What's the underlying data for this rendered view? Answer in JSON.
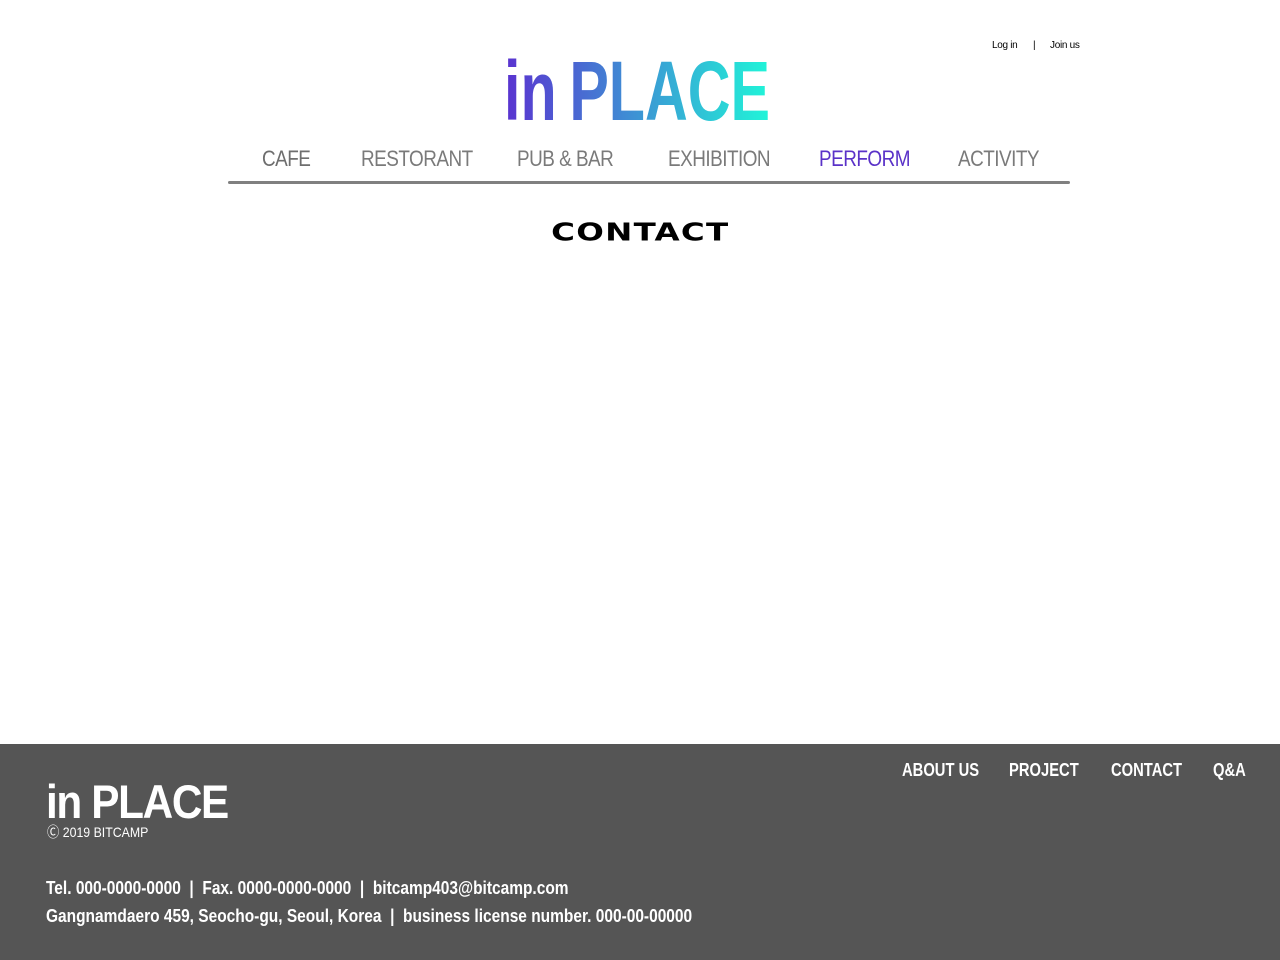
{
  "header": {
    "account": {
      "login_label": "Log in",
      "separator": "|",
      "join_label": "Join us"
    },
    "logo": {
      "text_in": "in",
      "text_place": "PLACE",
      "gradient_start": "#5a32d0",
      "gradient_end": "#20f5d8"
    }
  },
  "main_nav": {
    "items": [
      {
        "label": "CAFE"
      },
      {
        "label": "RESTORANT"
      },
      {
        "label": "PUB & BAR"
      },
      {
        "label": "EXHIBITION"
      },
      {
        "label": "PERFORM",
        "active": true
      },
      {
        "label": "ACTIVITY"
      }
    ],
    "active_color": "#5a32c8",
    "inactive_color": "#7a7a7a"
  },
  "content": {
    "page_title": "CONTACT"
  },
  "footer": {
    "logo_text": "in PLACE",
    "copyright": "Ⓒ 2019 BITCAMP",
    "nav": [
      {
        "label": "ABOUT US"
      },
      {
        "label": "PROJECT"
      },
      {
        "label": "CONTACT"
      },
      {
        "label": "Q&A"
      }
    ],
    "tel": "Tel. 000-0000-0000",
    "fax": "Fax. 0000-0000-0000",
    "email": "bitcamp403@bitcamp.com",
    "address": "Gangnamdaero 459, Seocho-gu, Seoul, Korea",
    "license": "business license number. 000-00-00000",
    "separator": "|",
    "background": "#555555"
  }
}
